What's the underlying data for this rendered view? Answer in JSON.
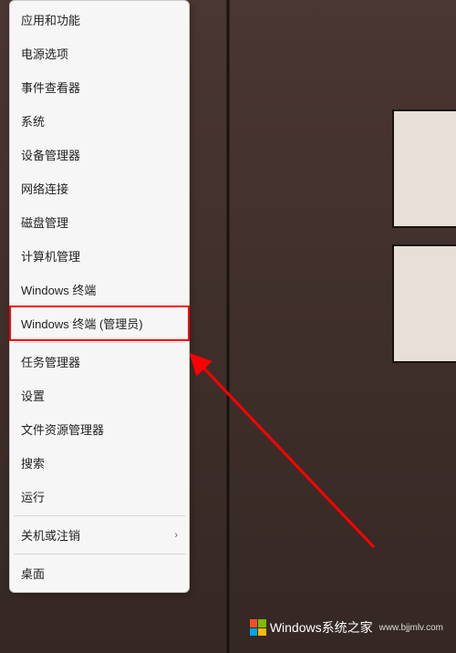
{
  "menu": {
    "items": [
      {
        "id": "apps-and-features",
        "label": "应用和功能",
        "hasSubmenu": false
      },
      {
        "id": "power-options",
        "label": "电源选项",
        "hasSubmenu": false
      },
      {
        "id": "event-viewer",
        "label": "事件查看器",
        "hasSubmenu": false
      },
      {
        "id": "system",
        "label": "系统",
        "hasSubmenu": false
      },
      {
        "id": "device-manager",
        "label": "设备管理器",
        "hasSubmenu": false
      },
      {
        "id": "network-connections",
        "label": "网络连接",
        "hasSubmenu": false
      },
      {
        "id": "disk-management",
        "label": "磁盘管理",
        "hasSubmenu": false
      },
      {
        "id": "computer-management",
        "label": "计算机管理",
        "hasSubmenu": false
      },
      {
        "id": "windows-terminal",
        "label": "Windows 终端",
        "hasSubmenu": false
      },
      {
        "id": "windows-terminal-admin",
        "label": "Windows 终端 (管理员)",
        "hasSubmenu": false,
        "highlighted": true
      },
      {
        "id": "task-manager",
        "label": "任务管理器",
        "hasSubmenu": false
      },
      {
        "id": "settings",
        "label": "设置",
        "hasSubmenu": false
      },
      {
        "id": "file-explorer",
        "label": "文件资源管理器",
        "hasSubmenu": false
      },
      {
        "id": "search",
        "label": "搜索",
        "hasSubmenu": false
      },
      {
        "id": "run",
        "label": "运行",
        "hasSubmenu": false
      },
      {
        "id": "shutdown-signout",
        "label": "关机或注销",
        "hasSubmenu": true
      },
      {
        "id": "desktop",
        "label": "桌面",
        "hasSubmenu": false
      }
    ],
    "dividers_after": [
      9,
      14,
      15
    ]
  },
  "watermark": {
    "main": "Windows系统之家",
    "sub": "www.bjjmlv.com"
  },
  "glyphs": {
    "chevron_right": "›"
  }
}
